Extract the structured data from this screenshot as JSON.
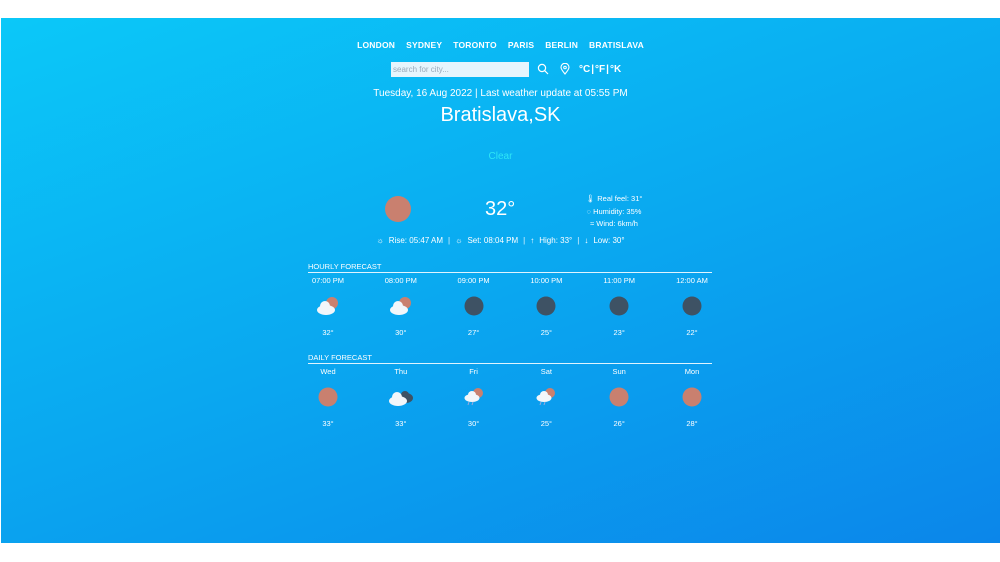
{
  "cities": [
    "LONDON",
    "SYDNEY",
    "TORONTO",
    "PARIS",
    "BERLIN",
    "BRATISLAVA"
  ],
  "search": {
    "placeholder": "search for city..."
  },
  "units": {
    "c": "°C",
    "sep": "|",
    "f": "°F",
    "k": "°K"
  },
  "date_line": "Tuesday, 16 Aug 2022 | Last weather update at 05:55 PM",
  "city_name": "Bratislava,SK",
  "condition": "Clear",
  "current": {
    "temp": "32°",
    "real_feel": "Real feel: 31°",
    "humidity": "Humidity: 35%",
    "wind": "Wind: 6km/h"
  },
  "stats": {
    "rise": "Rise: 05:47 AM",
    "set": "Set: 08:04 PM",
    "high": "High: 33°",
    "low": "Low: 30°",
    "sep": "|"
  },
  "hourly": {
    "title": "HOURLY FORECAST",
    "items": [
      {
        "label": "07:00 PM",
        "icon": "partly-cloudy-icon",
        "temp": "32°"
      },
      {
        "label": "08:00 PM",
        "icon": "partly-cloudy-icon",
        "temp": "30°"
      },
      {
        "label": "09:00 PM",
        "icon": "moon-icon",
        "temp": "27°"
      },
      {
        "label": "10:00 PM",
        "icon": "moon-icon",
        "temp": "25°"
      },
      {
        "label": "11:00 PM",
        "icon": "moon-icon",
        "temp": "23°"
      },
      {
        "label": "12:00 AM",
        "icon": "moon-icon",
        "temp": "22°"
      }
    ]
  },
  "daily": {
    "title": "DAILY FORECAST",
    "items": [
      {
        "label": "Wed",
        "icon": "sun-icon",
        "temp": "33°"
      },
      {
        "label": "Thu",
        "icon": "cloudy-icon",
        "temp": "33°"
      },
      {
        "label": "Fri",
        "icon": "rain-icon",
        "temp": "30°"
      },
      {
        "label": "Sat",
        "icon": "rain-icon",
        "temp": "25°"
      },
      {
        "label": "Sun",
        "icon": "sun-icon",
        "temp": "26°"
      },
      {
        "label": "Mon",
        "icon": "sun-icon",
        "temp": "28°"
      }
    ]
  },
  "colors": {
    "sun": "#c9806f",
    "moon": "#3e5264",
    "condition": "#2ee6f6"
  }
}
